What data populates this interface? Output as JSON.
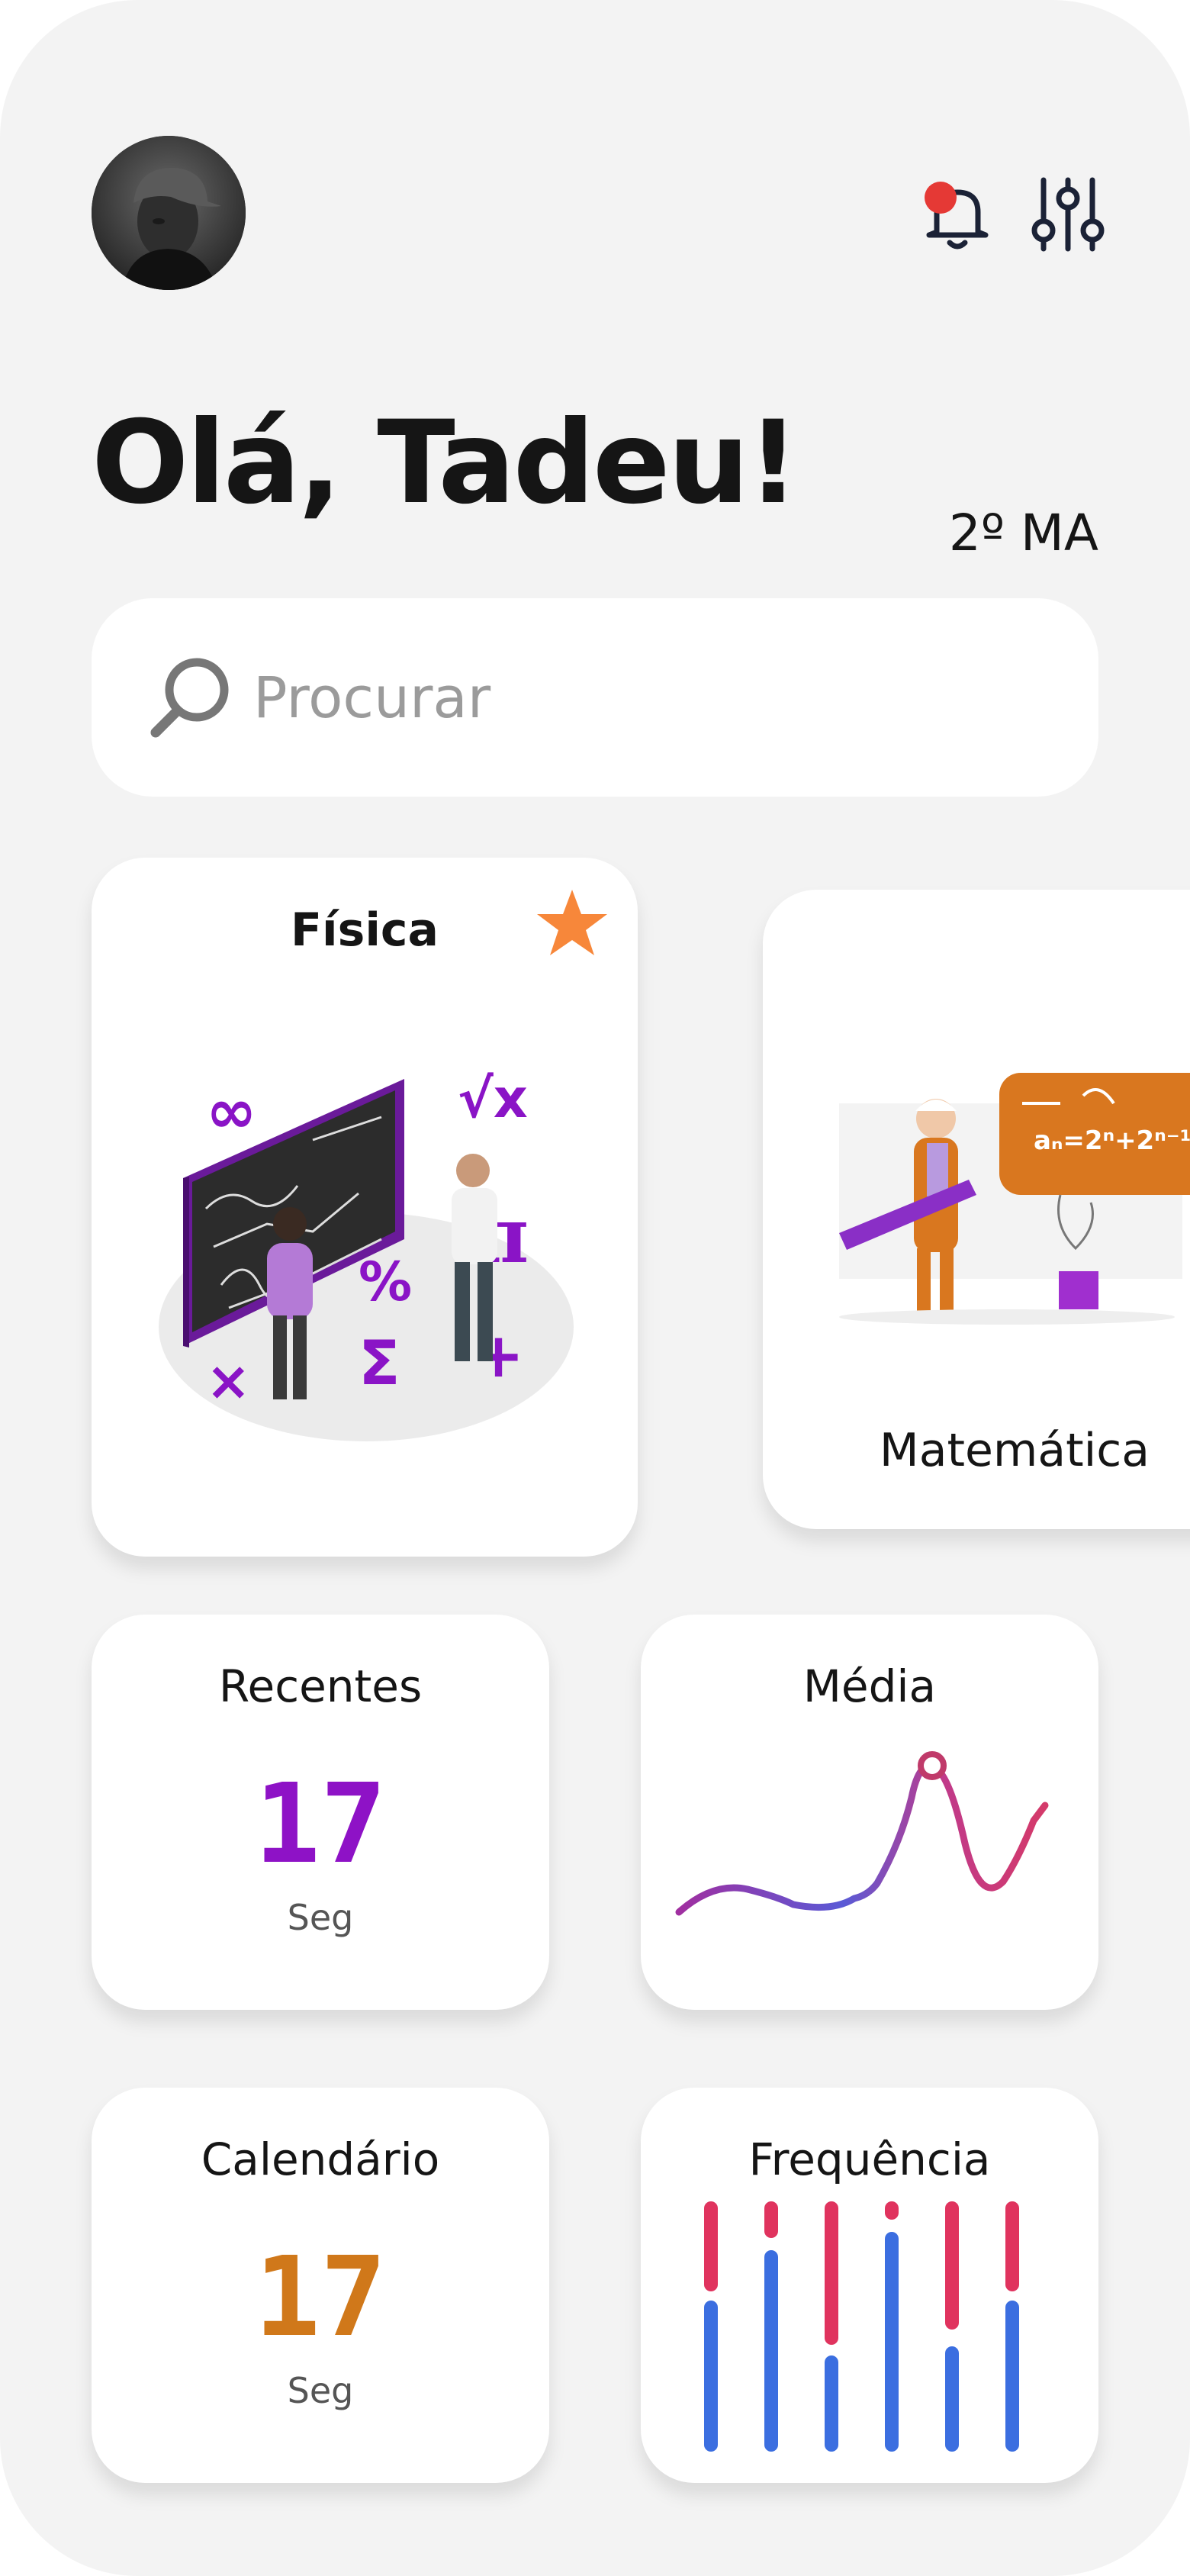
{
  "header": {
    "greeting": "Olá, Tadeu!",
    "class_label": "2º MA",
    "notification_dot_color": "#e53935"
  },
  "search": {
    "placeholder": "Procurar"
  },
  "subjects": [
    {
      "name": "Física",
      "favorite": true,
      "star_color": "#f7873a"
    },
    {
      "name": "Matemática",
      "favorite": false
    }
  ],
  "widgets": {
    "recentes": {
      "title": "Recentes",
      "number": "17",
      "day": "Seg",
      "color": "#8e12c6"
    },
    "media": {
      "title": "Média"
    },
    "calendario": {
      "title": "Calendário",
      "number": "17",
      "day": "Seg",
      "color": "#d0781a"
    },
    "frequencia": {
      "title": "Frequência",
      "present_color": "#3b6ee0",
      "absent_color": "#e0335e"
    }
  }
}
